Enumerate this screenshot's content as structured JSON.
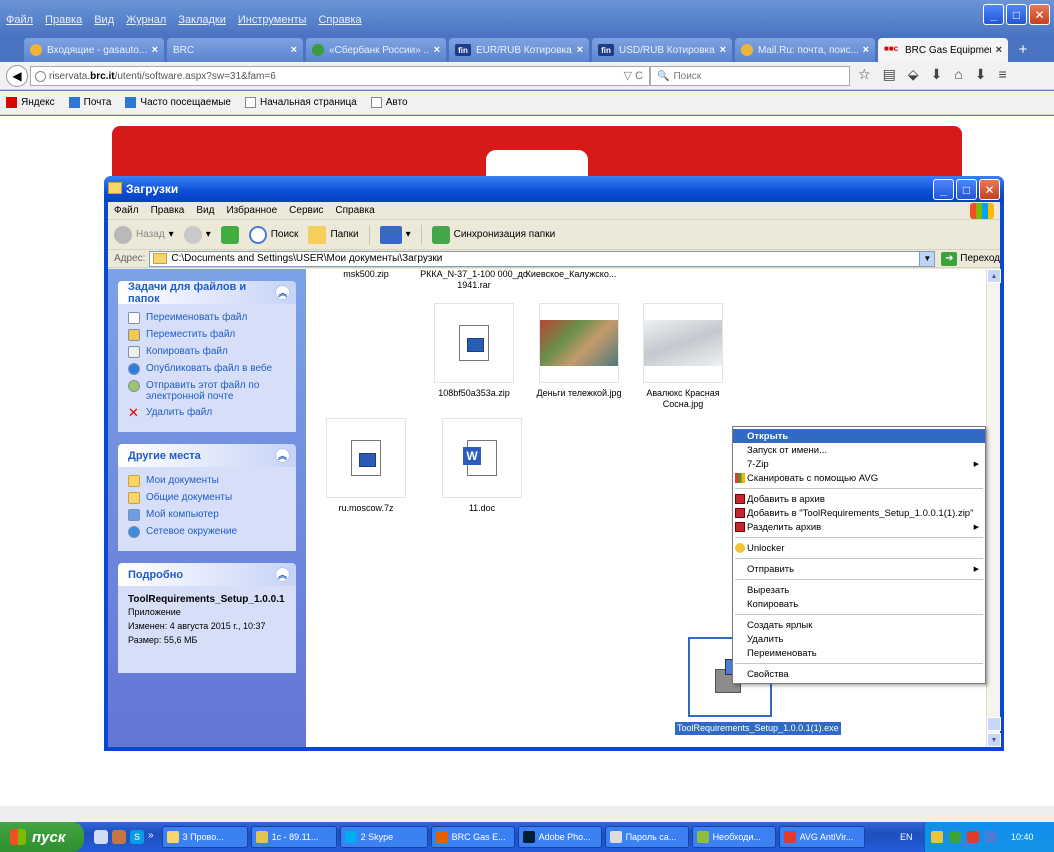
{
  "firefox": {
    "menu": [
      "Файл",
      "Правка",
      "Вид",
      "Журнал",
      "Закладки",
      "Инструменты",
      "Справка"
    ],
    "tabs": [
      {
        "label": "Входящие - gasauto...",
        "active": false
      },
      {
        "label": "BRC",
        "active": false
      },
      {
        "label": "«Сбербанк России» ...",
        "active": false
      },
      {
        "label": "EUR/RUB Котировка...",
        "active": false
      },
      {
        "label": "USD/RUB Котировка...",
        "active": false
      },
      {
        "label": "Mail.Ru: почта, поис...",
        "active": false
      },
      {
        "label": "BRC Gas Equipment",
        "active": true
      }
    ],
    "fin_badge": "fin",
    "brc_badge": "■■c",
    "new_tab": "+",
    "url_prefix": "riservata.",
    "url_host": "brc.it",
    "url_path": "/utenti/software.aspx?sw=31&fam=6",
    "url_buttons": "▽ C",
    "search_placeholder": "Поиск",
    "nav_icons": [
      "☆",
      "▤",
      "⬙",
      "⬇",
      "⌂",
      "⬇",
      "≡"
    ],
    "bookmarks": [
      "Яндекс",
      "Почта",
      "Часто посещаемые",
      "Начальная страница",
      "Авто"
    ]
  },
  "explorer": {
    "title": "Загрузки",
    "menu": [
      "Файл",
      "Правка",
      "Вид",
      "Избранное",
      "Сервис",
      "Справка"
    ],
    "toolbar": {
      "back": "Назад",
      "search": "Поиск",
      "folders": "Папки",
      "sync": "Синхронизация папки"
    },
    "address_label": "Адрес:",
    "address": "C:\\Documents and Settings\\USER\\Мои документы\\Загрузки",
    "go": "Переход",
    "tasks_title": "Задачи для файлов и папок",
    "tasks": [
      "Переименовать файл",
      "Переместить файл",
      "Копировать файл",
      "Опубликовать файл в вебе",
      "Отправить этот файл по электронной почте",
      "Удалить файл"
    ],
    "places_title": "Другие места",
    "places": [
      "Мои документы",
      "Общие документы",
      "Мой компьютер",
      "Сетевое окружение"
    ],
    "details_title": "Подробно",
    "details_name": "ToolRequirements_Setup_1.0.0.1",
    "details_type": "Приложение",
    "details_modified": "Изменен: 4 августа 2015 г., 10:37",
    "details_size": "Размер: 55,6 МБ",
    "files_top_cut": [
      "msk500.zip",
      "РККА_N-37_1-100 000_до 1941.rar",
      "Киевское_Калужско..."
    ],
    "files": [
      {
        "name": "108bf50a353a.zip",
        "kind": "zip"
      },
      {
        "name": "Деньги тележкой.jpg",
        "kind": "photo"
      },
      {
        "name": "Авалюкс Красная Сосна.jpg",
        "kind": "map"
      },
      {
        "name": "ru.moscow.7z",
        "kind": "zip"
      },
      {
        "name": "11.doc",
        "kind": "doc"
      },
      {
        "name": "ToolRequirements_Setup_1.0.0.1(1).exe",
        "kind": "exe"
      }
    ]
  },
  "context_menu": {
    "items": [
      "Открыть",
      "Запуск от имени...",
      "7-Zip",
      "Сканировать с помощью AVG",
      "Добавить в архив",
      "Добавить в \"ToolRequirements_Setup_1.0.0.1(1).zip\"",
      "Разделить архив",
      "Unlocker",
      "Отправить",
      "Вырезать",
      "Копировать",
      "Создать ярлык",
      "Удалить",
      "Переименовать",
      "Свойства"
    ]
  },
  "taskbar": {
    "start": "пуск",
    "quick_more": "»",
    "buttons": [
      "3 Прово...",
      "1c - 89.11...",
      "2 Skype",
      "BRC Gas E...",
      "Adobe Pho...",
      "Пароль са...",
      "Необходи...",
      "AVG AntiVir..."
    ],
    "lang": "EN",
    "clock": "10:40"
  },
  "colors": {
    "accent": "#316ac5",
    "xp_blue": "#0a47d4",
    "brc_red": "#d61a1a"
  }
}
